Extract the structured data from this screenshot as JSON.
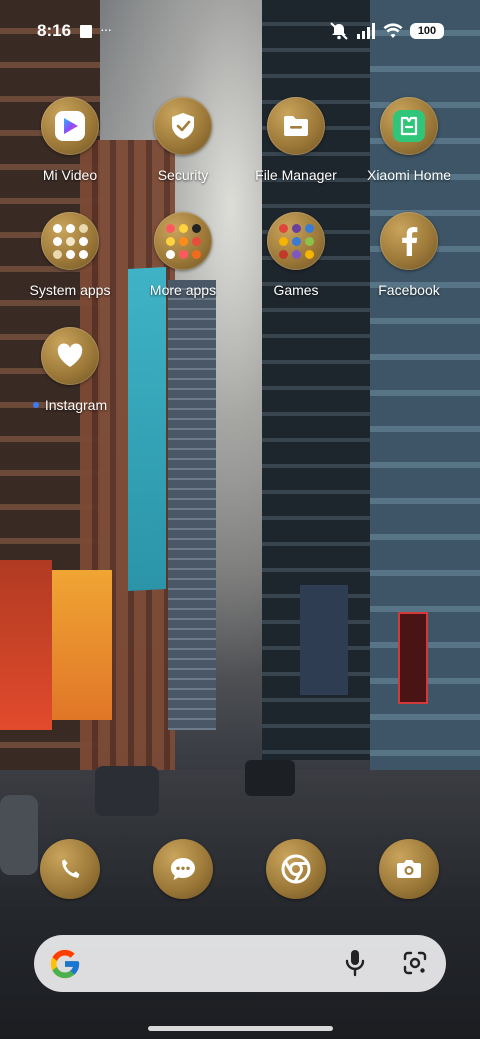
{
  "status_bar": {
    "time": "8:16",
    "overflow": "···",
    "battery_level": "100",
    "icons": [
      "silent-mode-icon",
      "signal-icon",
      "wifi-icon",
      "battery-icon"
    ]
  },
  "home_apps": [
    {
      "label": "Mi Video",
      "icon": "mi-video-icon"
    },
    {
      "label": "Security",
      "icon": "shield-check-icon"
    },
    {
      "label": "File Manager",
      "icon": "folder-icon"
    },
    {
      "label": "Xiaomi Home",
      "icon": "xiaomi-home-icon"
    },
    {
      "label": "System apps",
      "icon": "folder-grid-icon"
    },
    {
      "label": "More apps",
      "icon": "folder-grid-icon"
    },
    {
      "label": "Games",
      "icon": "folder-grid-icon"
    },
    {
      "label": "Facebook",
      "icon": "facebook-icon"
    },
    {
      "label": "Instagram",
      "icon": "heart-icon",
      "new_indicator_color": "#3d7bf4"
    }
  ],
  "dock": [
    {
      "icon": "phone-icon"
    },
    {
      "icon": "messages-icon"
    },
    {
      "icon": "chrome-icon"
    },
    {
      "icon": "camera-icon"
    }
  ],
  "search_bar": {
    "placeholder": "",
    "icons": [
      "google-g-icon",
      "microphone-icon",
      "google-lens-icon"
    ]
  },
  "colors": {
    "icon_gold": "#9e7a3a",
    "accent_blue": "#3d7bf4",
    "search_bg": "#eeeef0"
  }
}
